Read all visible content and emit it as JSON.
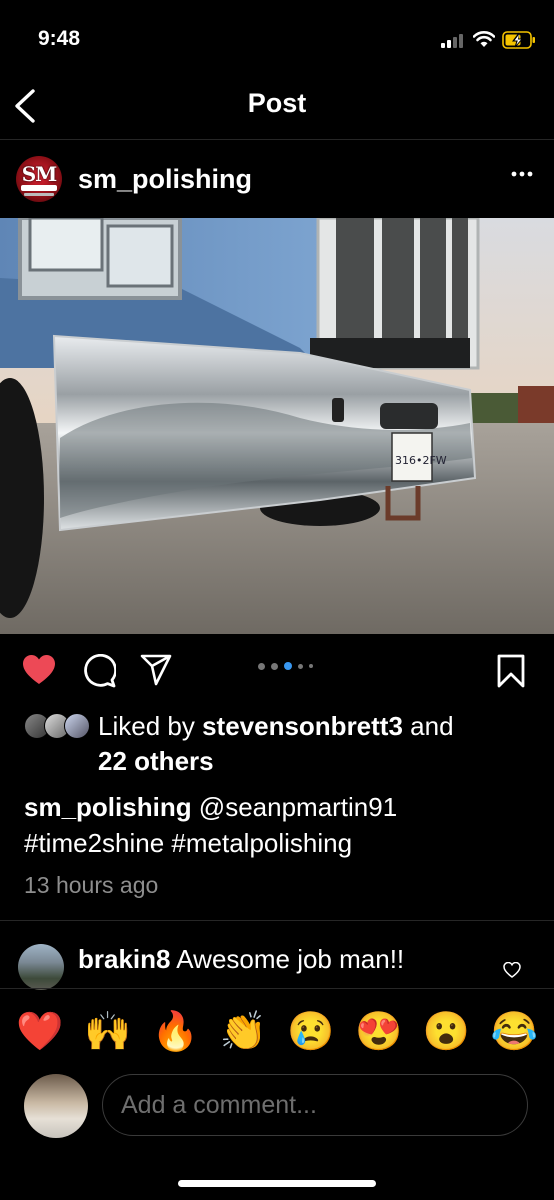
{
  "status_bar": {
    "time": "9:48",
    "signal_icon": "cellular-signal-icon",
    "wifi_icon": "wifi-icon",
    "battery_icon": "battery-charging-icon",
    "battery_color": "#f5c400"
  },
  "nav": {
    "title": "Post",
    "back_icon": "chevron-left-icon"
  },
  "post": {
    "username": "sm_polishing",
    "more_icon": "more-horizontal-icon",
    "carousel": {
      "count": 5,
      "active_index": 2
    },
    "liked": true,
    "like_color": "#ed4956"
  },
  "likes": {
    "prefix": "Liked by ",
    "user": "stevensonbrett3",
    "and": " and",
    "others": "22 others"
  },
  "caption": {
    "username": "sm_polishing",
    "mention": " @seanpmartin91",
    "hashtags": "#time2shine #metalpolishing"
  },
  "time_ago": "13 hours ago",
  "comments": [
    {
      "username": "brakin8",
      "text": " Awesome job man!!"
    }
  ],
  "reactions": [
    "❤️",
    "🙌",
    "🔥",
    "👏",
    "😢",
    "😍",
    "😮",
    "😂"
  ],
  "comment_input": {
    "placeholder": "Add a comment..."
  }
}
